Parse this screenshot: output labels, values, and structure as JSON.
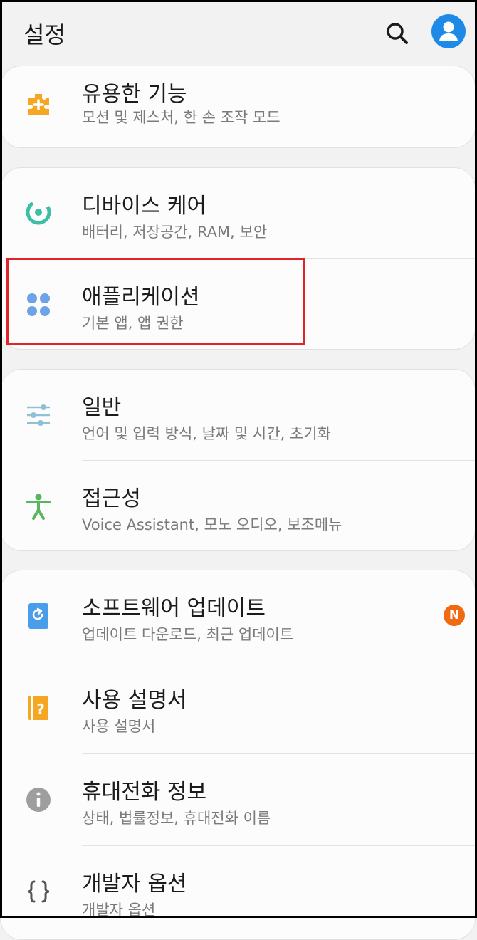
{
  "header": {
    "title": "설정"
  },
  "items": [
    {
      "title": "유용한 기능",
      "subtitle": "모션 및 제스처, 한 손 조작 모드",
      "icon": "puzzle-plus-icon"
    },
    {
      "title": "디바이스 케어",
      "subtitle": "배터리, 저장공간, RAM, 보안",
      "icon": "device-care-icon"
    },
    {
      "title": "애플리케이션",
      "subtitle": "기본 앱, 앱 권한",
      "icon": "apps-grid-icon"
    },
    {
      "title": "일반",
      "subtitle": "언어 및 입력 방식, 날짜 및 시간, 초기화",
      "icon": "sliders-icon"
    },
    {
      "title": "접근성",
      "subtitle": "Voice Assistant, 모노 오디오, 보조메뉴",
      "icon": "accessibility-person-icon"
    },
    {
      "title": "소프트웨어 업데이트",
      "subtitle": "업데이트 다운로드, 최근 업데이트",
      "icon": "software-update-icon",
      "badge": "N"
    },
    {
      "title": "사용 설명서",
      "subtitle": "사용 설명서",
      "icon": "user-manual-icon"
    },
    {
      "title": "휴대전화 정보",
      "subtitle": "상태, 법률정보, 휴대전화 이름",
      "icon": "info-icon"
    },
    {
      "title": "개발자 옵션",
      "subtitle": "개발자 옵션",
      "icon": "developer-braces-icon"
    }
  ],
  "colors": {
    "accent": "#1e8ae8",
    "badge": "#f06a12",
    "highlight": "#e2232a"
  }
}
